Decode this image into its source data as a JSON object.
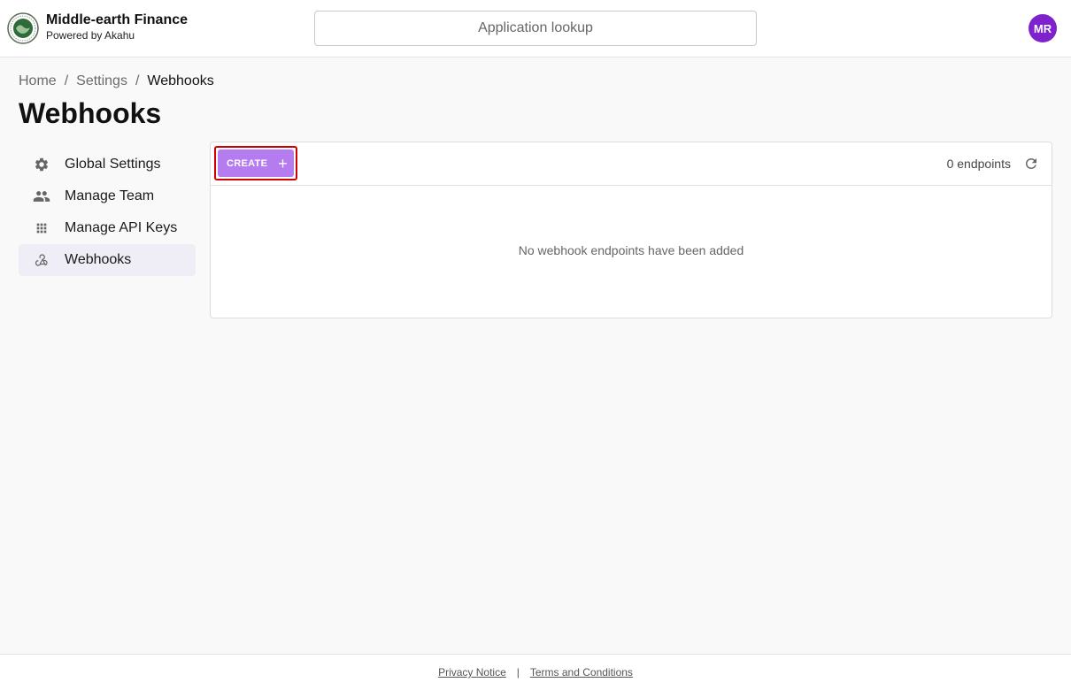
{
  "brand": {
    "name": "Middle-earth Finance",
    "subtitle": "Powered by Akahu"
  },
  "search": {
    "placeholder": "Application lookup"
  },
  "user": {
    "initials": "MR",
    "avatar_color": "#7e22ce"
  },
  "breadcrumb": {
    "items": [
      "Home",
      "Settings",
      "Webhooks"
    ],
    "separator": "/"
  },
  "page": {
    "title": "Webhooks"
  },
  "sidebar": {
    "items": [
      {
        "label": "Global Settings",
        "icon": "gear-icon"
      },
      {
        "label": "Manage Team",
        "icon": "team-icon"
      },
      {
        "label": "Manage API Keys",
        "icon": "grid-icon"
      },
      {
        "label": "Webhooks",
        "icon": "webhook-icon",
        "active": true
      }
    ]
  },
  "panel": {
    "create_label": "CREATE",
    "create_color": "#b57cf0",
    "endpoint_count": "0 endpoints",
    "empty_message": "No webhook endpoints have been added"
  },
  "footer": {
    "privacy": "Privacy Notice",
    "divider": "|",
    "terms": "Terms and Conditions"
  }
}
